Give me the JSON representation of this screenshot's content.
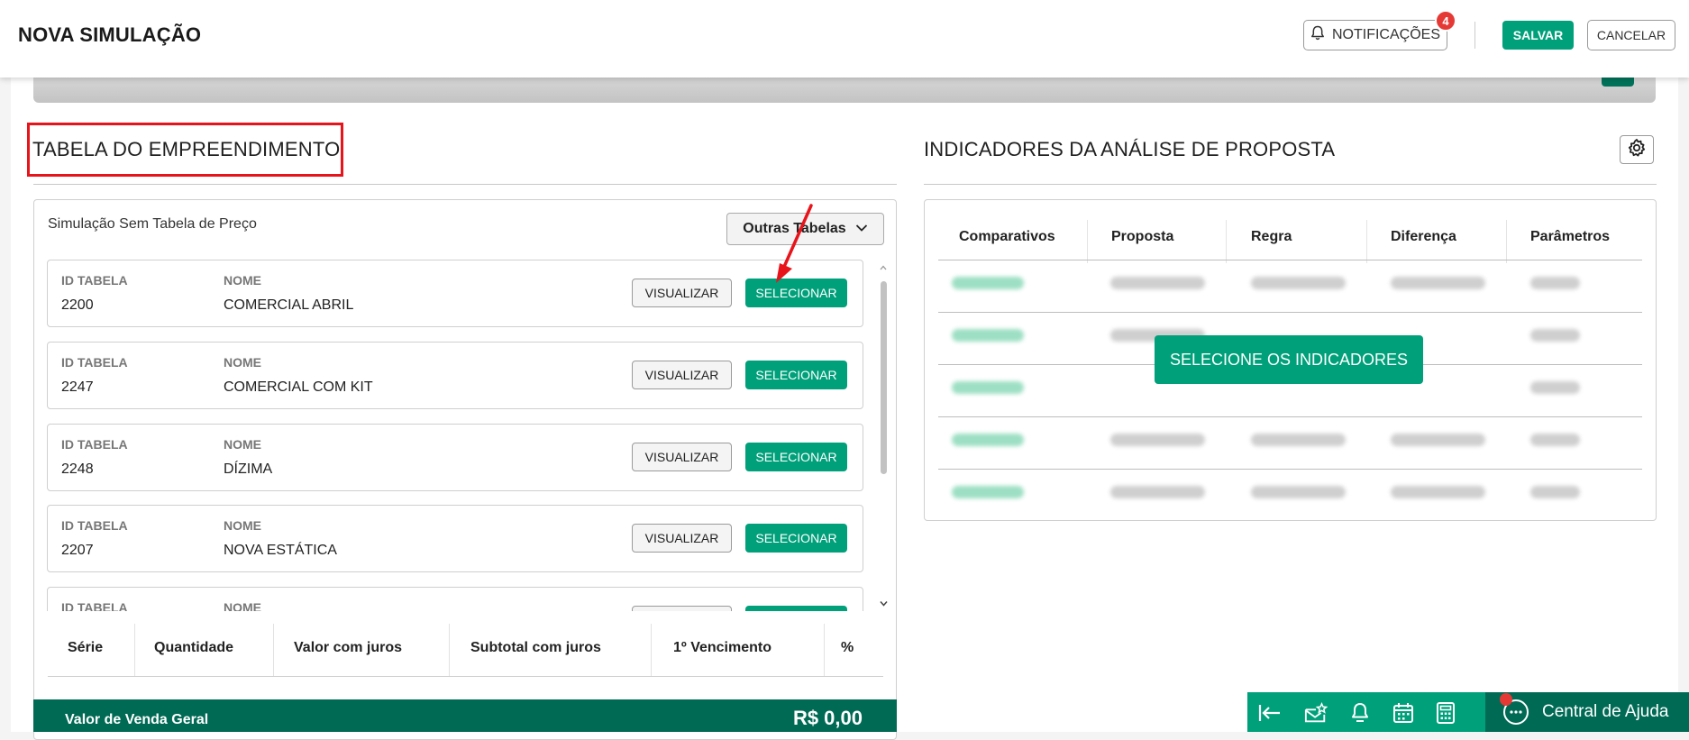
{
  "header": {
    "title": "NOVA SIMULAÇÃO",
    "notifications_label": "NOTIFICAÇÕES",
    "notifications_count": "4",
    "save_label": "SALVAR",
    "cancel_label": "CANCELAR"
  },
  "left_section": {
    "title": "TABELA DO EMPREENDIMENTO",
    "subtitle": "Simulação Sem Tabela de Preço",
    "other_tables_label": "Outras Tabelas",
    "id_label": "ID TABELA",
    "name_label": "NOME",
    "view_label": "VISUALIZAR",
    "select_label": "SELECIONAR",
    "rows": [
      {
        "id": "2200",
        "name": "COMERCIAL ABRIL"
      },
      {
        "id": "2247",
        "name": "COMERCIAL COM KIT"
      },
      {
        "id": "2248",
        "name": "DÍZIMA"
      },
      {
        "id": "2207",
        "name": "NOVA ESTÁTICA"
      },
      {
        "id": "",
        "name": ""
      }
    ],
    "columns": [
      "Série",
      "Quantidade",
      "Valor com juros",
      "Subtotal com juros",
      "1º Vencimento",
      "%"
    ],
    "footer_label": "Valor de Venda Geral",
    "footer_value": "R$ 0,00"
  },
  "right_section": {
    "title": "INDICADORES DA ANÁLISE DE PROPOSTA",
    "columns": [
      "Comparativos",
      "Proposta",
      "Regra",
      "Diferença",
      "Parâmetros"
    ],
    "select_indicators_label": "SELECIONE OS INDICADORES"
  },
  "help_bar": {
    "label": "Central de Ajuda"
  },
  "colors": {
    "primary": "#00a07a",
    "dark_green": "#006a55",
    "highlight_red": "#e8141b",
    "badge_red": "#e53935"
  }
}
